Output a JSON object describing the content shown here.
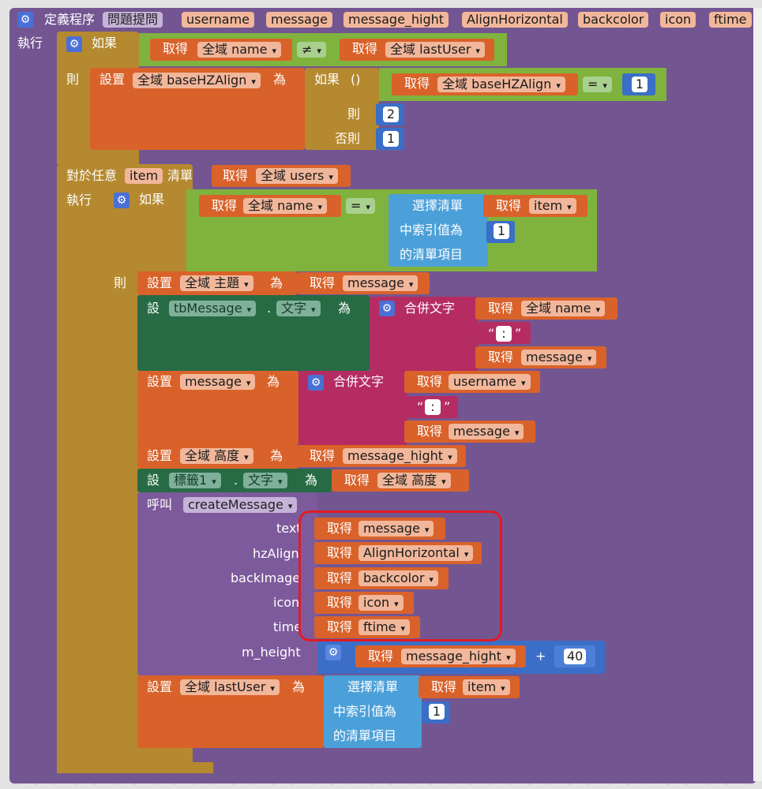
{
  "proc_header": {
    "keyword": "定義程序",
    "name": "問題提問",
    "params": [
      "username",
      "message",
      "message_hight",
      "AlignHorizontal",
      "backcolor",
      "icon",
      "ftime"
    ],
    "do_label": "執行"
  },
  "if1": {
    "if_label": "如果",
    "get_label": "取得",
    "left_var": "全域 name",
    "operator": "≠",
    "right_var": "全域 lastUser",
    "then_label": "則",
    "set_label": "設置",
    "set_var": "全域 baseHZAlign",
    "to_label": "為",
    "ternary_if": "如果",
    "paren": "()",
    "cond_var": "全域 baseHZAlign",
    "cond_op": "=",
    "cond_num": "1",
    "then2_label": "則",
    "then_num": "2",
    "else_label": "否則",
    "else_num": "1"
  },
  "foreach": {
    "label_prefix": "對於任意",
    "item_var": "item",
    "list_label": "清單",
    "get_label": "取得",
    "list_var": "全域 users",
    "do_label": "執行"
  },
  "if2": {
    "if_label": "如果",
    "get_label": "取得",
    "left_var": "全域 name",
    "operator": "=",
    "select_line1": "選擇清單",
    "select_line2": "中索引值為",
    "select_line3": "的清單項目",
    "item_var": "item",
    "index_num": "1",
    "then_label": "則"
  },
  "body": {
    "set_label": "設置",
    "set_short": "設",
    "to_label": "為",
    "get_label": "取得",
    "dot": ".",
    "join_label": "合併文字",
    "colon_text": ":",
    "topic_var": "全域 主題",
    "message_var": "message",
    "tb_component": "tbMessage",
    "text_prop": "文字",
    "name_var": "全域 name",
    "username_var": "username",
    "height_var": "全域 高度",
    "message_hight_var": "message_hight",
    "label_component": "標籤1",
    "height_get": "全域 高度"
  },
  "call": {
    "call_label": "呼叫",
    "proc_name": "createMessage",
    "arg_labels": [
      "text",
      "hzAlign",
      "backImage",
      "icon",
      "time",
      "m_height"
    ],
    "arg_vars": [
      "message",
      "AlignHorizontal",
      "backcolor",
      "icon",
      "ftime"
    ],
    "m_height_var": "message_hight",
    "plus": "+",
    "add_num": "40"
  },
  "last": {
    "set_label": "設置",
    "var": "全域 lastUser",
    "to_label": "為",
    "select_line1": "選擇清單",
    "select_line2": "中索引值為",
    "select_line3": "的清單項目",
    "get_label": "取得",
    "item_var": "item",
    "index_num": "1"
  },
  "colors": {
    "procedure": "#735691",
    "control": "#b5892f",
    "variable": "#d9622a",
    "logic": "#7fb33d",
    "text": "#b52c63",
    "list": "#4ba0d9",
    "math": "#3a6ec7",
    "component": "#276b45",
    "highlight": "#e01b24"
  }
}
